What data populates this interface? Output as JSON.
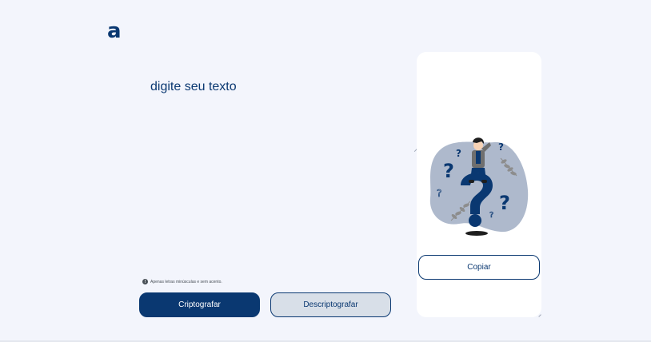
{
  "logo": {
    "text": "a"
  },
  "input": {
    "placeholder": "digite seu texto",
    "value": ""
  },
  "hint": {
    "icon": "info-icon",
    "text": "Apenas letras minúsculas e sem acento."
  },
  "actions": {
    "encrypt_label": "Criptografar",
    "decrypt_label": "Descriptografar"
  },
  "output": {
    "illustration": "person-on-question-mark-illustration",
    "copy_label": "Copiar"
  },
  "colors": {
    "background": "#f3f5fc",
    "primary": "#0a3871",
    "secondary": "#d8dfe8",
    "panel": "#ffffff"
  }
}
